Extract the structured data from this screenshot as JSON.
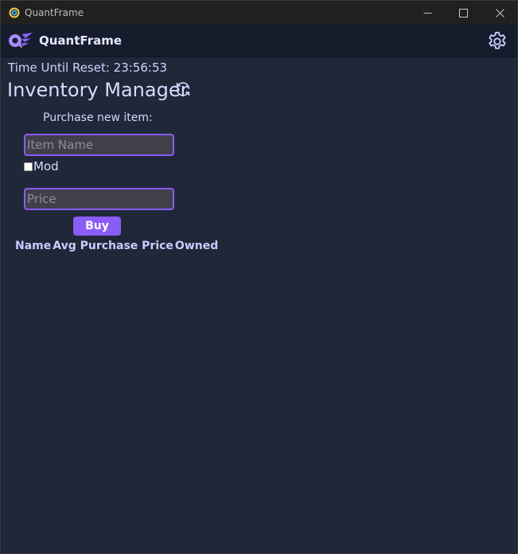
{
  "window": {
    "title": "QuantFrame",
    "controls": {
      "minimize_icon": "minimize-icon",
      "maximize_icon": "maximize-icon",
      "close_icon": "close-icon"
    }
  },
  "header": {
    "app_name": "QuantFrame",
    "logo_icon": "quantframe-logo-icon",
    "settings_icon": "gear-icon"
  },
  "reset": {
    "text": "Time Until Reset: 23:56:53"
  },
  "page": {
    "title": "Inventory Manager",
    "refresh_icon": "refresh-icon"
  },
  "purchase_form": {
    "label": "Purchase new item:",
    "item_name": {
      "value": "",
      "placeholder": "Item Name"
    },
    "mod_checkbox": {
      "label": "Mod",
      "checked": false
    },
    "price": {
      "value": "",
      "placeholder": "Price"
    },
    "buy_label": "Buy"
  },
  "table": {
    "columns": [
      "Name",
      "Avg Purchase Price",
      "Owned"
    ],
    "rows": []
  },
  "colors": {
    "accent": "#8b5cf6",
    "background": "#1f2738",
    "header_bg": "#151c2b",
    "titlebar_bg": "#202020"
  }
}
